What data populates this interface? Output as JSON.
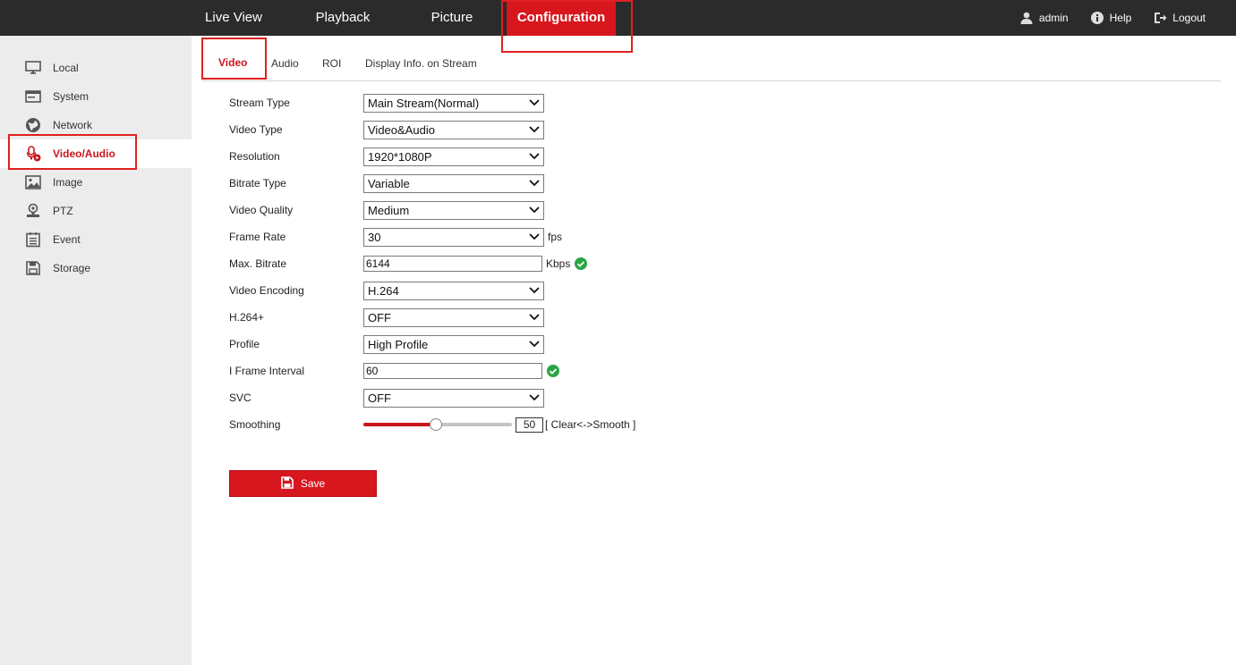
{
  "topnav": {
    "items": [
      {
        "label": "Live View"
      },
      {
        "label": "Playback"
      },
      {
        "label": "Picture"
      },
      {
        "label": "Configuration"
      }
    ],
    "active_index": 3
  },
  "toolbar": {
    "user": "admin",
    "help": "Help",
    "logout": "Logout"
  },
  "sidebar": {
    "items": [
      {
        "label": "Local",
        "icon": "monitor-icon"
      },
      {
        "label": "System",
        "icon": "system-window-icon"
      },
      {
        "label": "Network",
        "icon": "globe-icon"
      },
      {
        "label": "Video/Audio",
        "icon": "microphone-video-icon"
      },
      {
        "label": "Image",
        "icon": "image-icon"
      },
      {
        "label": "PTZ",
        "icon": "ptz-camera-icon"
      },
      {
        "label": "Event",
        "icon": "event-list-icon"
      },
      {
        "label": "Storage",
        "icon": "floppy-disk-icon"
      }
    ],
    "active_index": 3
  },
  "tabs": {
    "items": [
      {
        "label": "Video"
      },
      {
        "label": "Audio"
      },
      {
        "label": "ROI"
      },
      {
        "label": "Display Info. on Stream"
      }
    ],
    "active_index": 0
  },
  "form": {
    "stream_type": {
      "label": "Stream Type",
      "value": "Main Stream(Normal)"
    },
    "video_type": {
      "label": "Video Type",
      "value": "Video&Audio"
    },
    "resolution": {
      "label": "Resolution",
      "value": "1920*1080P"
    },
    "bitrate_type": {
      "label": "Bitrate Type",
      "value": "Variable"
    },
    "video_quality": {
      "label": "Video Quality",
      "value": "Medium"
    },
    "frame_rate": {
      "label": "Frame Rate",
      "value": "30",
      "unit": "fps"
    },
    "max_bitrate": {
      "label": "Max. Bitrate",
      "value": "6144",
      "unit": "Kbps"
    },
    "video_encoding": {
      "label": "Video Encoding",
      "value": "H.264"
    },
    "h264_plus": {
      "label": "H.264+",
      "value": "OFF"
    },
    "profile": {
      "label": "Profile",
      "value": "High Profile"
    },
    "i_frame_interval": {
      "label": "I Frame Interval",
      "value": "60"
    },
    "svc": {
      "label": "SVC",
      "value": "OFF"
    },
    "smoothing": {
      "label": "Smoothing",
      "value": "50",
      "percent": 50,
      "hint": "[ Clear<->Smooth ]"
    }
  },
  "save": {
    "label": "Save"
  },
  "colors": {
    "accent": "#d7161e",
    "topbar": "#2b2b2b",
    "sidebar": "#ececec",
    "ok_green": "#2aa543"
  }
}
